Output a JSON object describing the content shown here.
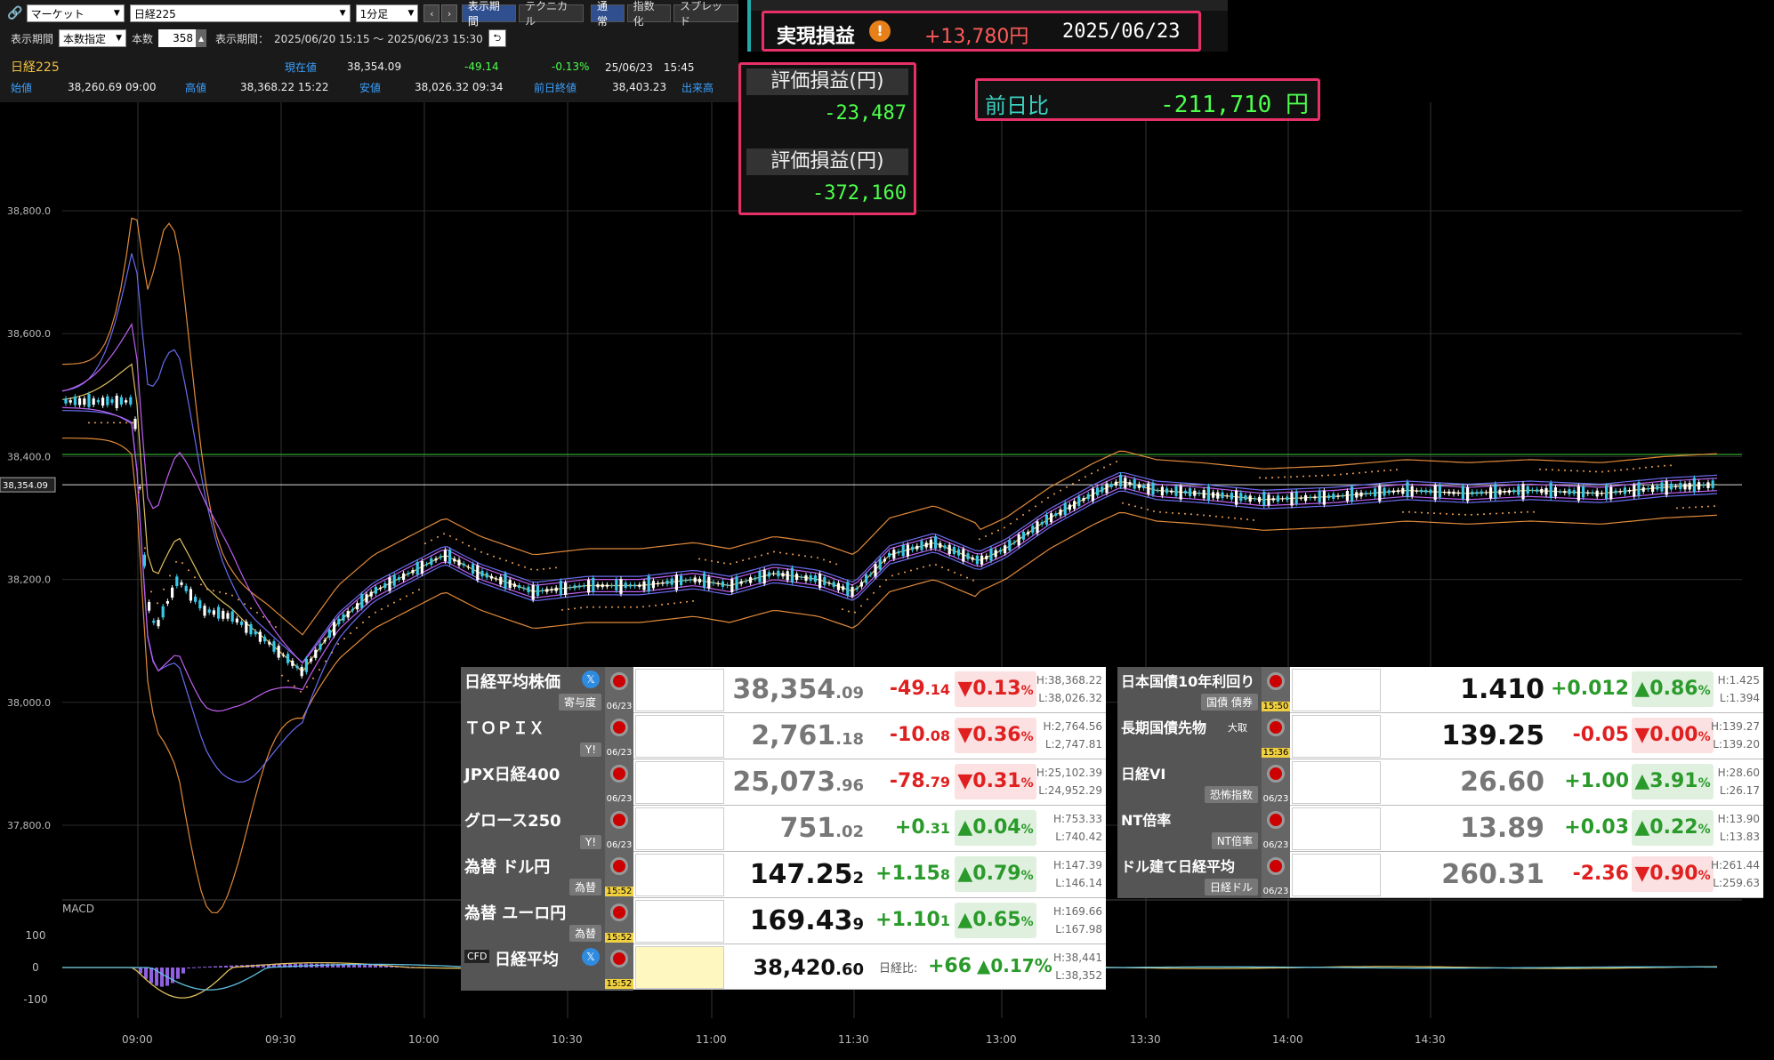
{
  "toolbar": {
    "link_icon": "link-icon",
    "market_select": "マーケット",
    "symbol_select": "日経225",
    "interval_select": "1分足",
    "display_period_btn": "表示期間",
    "technical_btn": "テクニカル",
    "mode_normal": "通常",
    "mode_index": "指数化",
    "mode_spread": "スプレッド",
    "period_label": "表示期間",
    "period_select": "本数指定",
    "count_label": "本数",
    "count_value": "358",
    "range_label": "表示期間：",
    "range_value": "2025/06/20 15:15 ～ 2025/06/23 15:30"
  },
  "quote_info": {
    "name": "日経225",
    "current_label": "現在値",
    "current_value": "38,354.09",
    "change": "-49.14",
    "change_pct": "-0.13%",
    "timestamp": "25/06/23　15:45",
    "open_label": "始値",
    "open_value": "38,260.69 09:00",
    "high_label": "高値",
    "high_value": "38,368.22 15:22",
    "low_label": "安値",
    "low_value": "38,026.32 09:34",
    "prev_label": "前日終値",
    "prev_value": "38,403.23",
    "volume_label": "出来高"
  },
  "pnl": {
    "realized_label": "実現損益",
    "realized_value": "+13,780円",
    "realized_date": "2025/06/23",
    "unrealized_label_1": "評価損益(円)",
    "unrealized_value_1": "-23,487",
    "unrealized_label_2": "評価損益(円)",
    "unrealized_value_2": "-372,160",
    "dod_label": "前日比",
    "dod_value": "-211,710 円"
  },
  "chart_data": {
    "type": "candlestick",
    "y_ticks": [
      "38,800.0",
      "38,600.0",
      "38,400.0",
      "38,200.0",
      "38,000.0",
      "37,800.0"
    ],
    "price_tag": "38,354.09",
    "x_ticks": [
      "09:00",
      "09:30",
      "10:00",
      "10:30",
      "11:00",
      "11:30",
      "13:00",
      "13:30",
      "14:00",
      "14:30"
    ],
    "macd_label": "MACD",
    "macd_ticks": [
      "100",
      "0",
      "-100"
    ],
    "prev_close_line": 38403.23,
    "colors": {
      "up": "#ffffff",
      "down": "#3ac8e8",
      "grid": "#2a2a2a",
      "prev_line": "#2a8a2a"
    }
  },
  "quotes_left": [
    {
      "name": "日経平均株価",
      "sub": "寄与度",
      "date": "06/23",
      "price_main": "38,354",
      "price_dec": ".09",
      "chg": "-49",
      "chg_dec": ".14",
      "pct": "▼0.13",
      "dir": "dn",
      "high": "H:38,368.22",
      "low": "L:38,026.32",
      "x": true
    },
    {
      "name": "ＴＯＰＩＸ",
      "sub": "Y!",
      "date": "06/23",
      "price_main": "2,761",
      "price_dec": ".18",
      "chg": "-10",
      "chg_dec": ".08",
      "pct": "▼0.36",
      "dir": "dn",
      "high": "H:2,764.56",
      "low": "L:2,747.81"
    },
    {
      "name": "JPX日経400",
      "sub": "",
      "date": "06/23",
      "price_main": "25,073",
      "price_dec": ".96",
      "chg": "-78",
      "chg_dec": ".79",
      "pct": "▼0.31",
      "dir": "dn",
      "high": "H:25,102.39",
      "low": "L:24,952.29"
    },
    {
      "name": "グロース250",
      "sub": "Y!",
      "date": "06/23",
      "price_main": "751",
      "price_dec": ".02",
      "chg": "+0",
      "chg_dec": ".31",
      "pct": "▲0.04",
      "dir": "up",
      "high": "H:753.33",
      "low": "L:740.42"
    },
    {
      "name": "為替 ドル円",
      "sub": "為替",
      "date": "15:52",
      "price_main": "147.25",
      "price_dec": "2",
      "chg": "+1.15",
      "chg_dec": "8",
      "pct": "▲0.79",
      "dir": "up",
      "high": "H:147.39",
      "low": "L:146.14",
      "dark": true
    },
    {
      "name": "為替 ユーロ円",
      "sub": "為替",
      "date": "15:52",
      "price_main": "169.43",
      "price_dec": "9",
      "chg": "+1.10",
      "chg_dec": "1",
      "pct": "▲0.65",
      "dir": "up",
      "high": "H:169.66",
      "low": "L:167.98",
      "dark": true
    }
  ],
  "cfd_row": {
    "name": "日経平均",
    "date": "15:52",
    "price_main": "38,420",
    "price_dec": ".60",
    "vs_label": "日経比:",
    "chg": "+66",
    "pct": "▲0.17%",
    "high": "H:38,441",
    "low": "L:38,352"
  },
  "quotes_right": [
    {
      "name": "日本国債10年利回り",
      "sub": "国債 債券",
      "date": "15:50",
      "price_main": "1.410",
      "chg": "+0.012",
      "pct": "▲0.86",
      "dir": "up",
      "high": "H:1.425",
      "low": "L:1.394"
    },
    {
      "name": "長期国債先物",
      "sub": "",
      "date": "15:36",
      "price_main": "139.25",
      "chg": "-0.05",
      "pct": "▼0.00",
      "dir": "dn",
      "high": "H:139.27",
      "low": "L:139.20"
    },
    {
      "name": "日経VI",
      "sub": "恐怖指数",
      "date": "06/23",
      "price_main": "26.60",
      "chg": "+1.00",
      "pct": "▲3.91",
      "dir": "up",
      "high": "H:28.60",
      "low": "L:26.17"
    },
    {
      "name": "NT倍率",
      "sub": "NT倍率",
      "date": "06/23",
      "price_main": "13.89",
      "chg": "+0.03",
      "pct": "▲0.22",
      "dir": "up",
      "high": "H:13.90",
      "low": "L:13.83"
    },
    {
      "name": "ドル建て日経平均",
      "sub": "日経ドル",
      "date": "06/23",
      "price_main": "260.31",
      "chg": "-2.36",
      "pct": "▼0.90",
      "dir": "dn",
      "high": "H:261.44",
      "low": "L:259.63"
    }
  ],
  "right_extra": {
    "osaka_tag": "大取"
  }
}
